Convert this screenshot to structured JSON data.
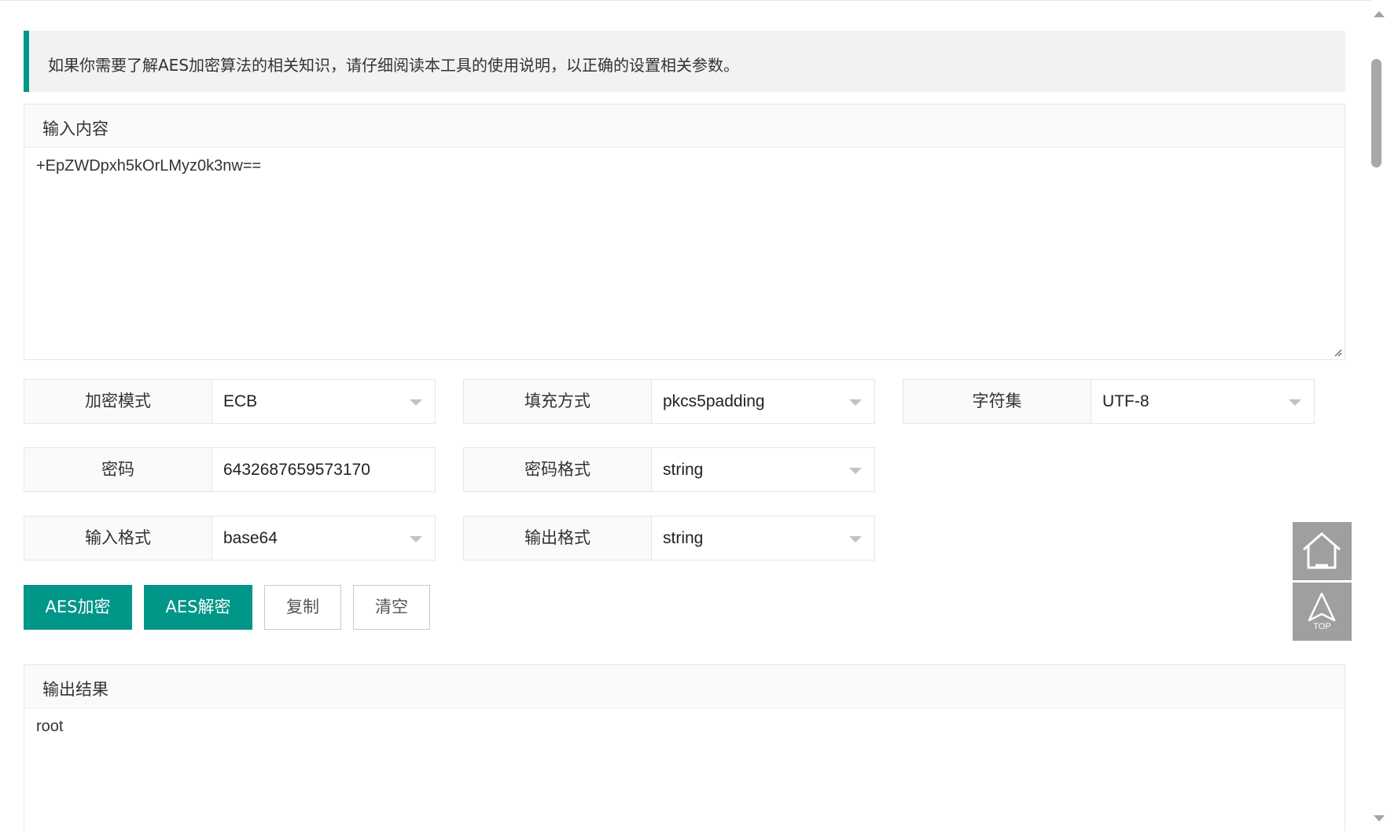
{
  "notice": {
    "text": "如果你需要了解AES加密算法的相关知识，请仔细阅读本工具的使用说明，以正确的设置相关参数。"
  },
  "input_panel": {
    "title": "输入内容",
    "value": "+EpZWDpxh5kOrLMyz0k3nw=="
  },
  "options": {
    "mode": {
      "label": "加密模式",
      "value": "ECB"
    },
    "padding": {
      "label": "填充方式",
      "value": "pkcs5padding"
    },
    "charset": {
      "label": "字符集",
      "value": "UTF-8"
    },
    "password": {
      "label": "密码",
      "value": "6432687659573170"
    },
    "password_format": {
      "label": "密码格式",
      "value": "string"
    },
    "input_format": {
      "label": "输入格式",
      "value": "base64"
    },
    "output_format": {
      "label": "输出格式",
      "value": "string"
    }
  },
  "buttons": {
    "encrypt": "AES加密",
    "decrypt": "AES解密",
    "copy": "复制",
    "clear": "清空"
  },
  "output_panel": {
    "title": "输出结果",
    "value": "root"
  },
  "sidebar": {
    "home_icon": "home-icon",
    "top_label": "TOP"
  },
  "colors": {
    "accent": "#009688",
    "sidetool": "#9f9f9f",
    "notice_bg": "#f2f2f2"
  }
}
